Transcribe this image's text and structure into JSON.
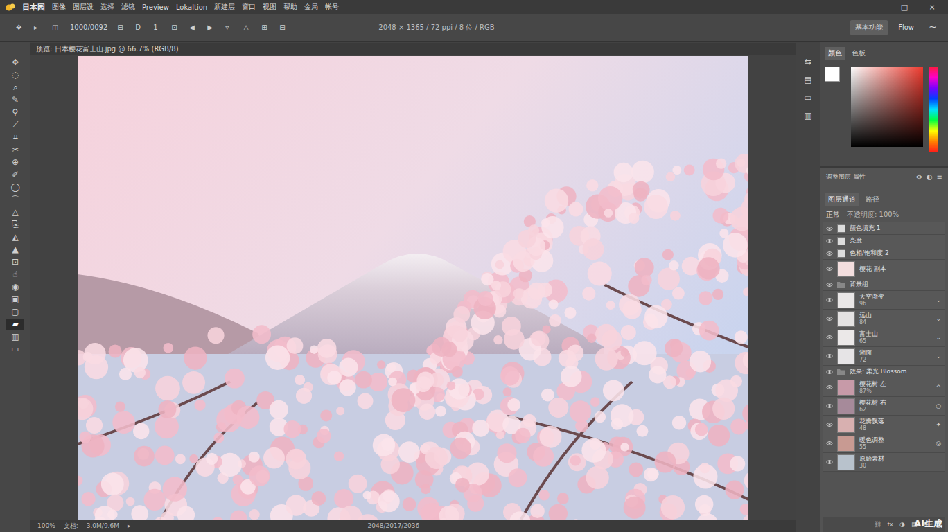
{
  "window": {
    "app_title": "日本园",
    "controls": [
      "—",
      "□",
      "×"
    ]
  },
  "menus": [
    "图像",
    "图层设",
    "选择",
    "滤镜",
    "Preview",
    "Lokaltion",
    "新建层",
    "窗口",
    "视图",
    "帮助",
    "金局",
    "帐号"
  ],
  "options": [
    "✥",
    "▸",
    "◫",
    "1000/0092",
    "⊟",
    "D",
    "1",
    "⊡",
    "◀",
    "▶",
    "▿",
    "△",
    "⊞",
    "⊟"
  ],
  "document_info": "2048 × 1365 / 72 ppi / 8 位 / RGB",
  "workspace_buttons": [
    {
      "label": "基本功能",
      "selected": true
    },
    {
      "label": "Flow",
      "selected": false
    },
    {
      "label": "⁓",
      "selected": false
    }
  ],
  "document_tab": "预览: 日本樱花富士山.jpg @ 66.7% (RGB/8)",
  "tools": [
    {
      "icon": "✥",
      "selected": false
    },
    {
      "icon": "◌",
      "selected": false
    },
    {
      "icon": "⌕",
      "selected": false
    },
    {
      "icon": "✎",
      "selected": false
    },
    {
      "icon": "⚲",
      "selected": false
    },
    {
      "icon": "⟋",
      "selected": false
    },
    {
      "icon": "⌗",
      "selected": false
    },
    {
      "icon": "✂",
      "selected": false
    },
    {
      "icon": "⊕",
      "selected": false
    },
    {
      "icon": "✐",
      "selected": false
    },
    {
      "icon": "◯",
      "selected": false
    },
    {
      "icon": "⌒",
      "selected": false
    },
    {
      "icon": "△",
      "selected": false
    },
    {
      "icon": "⎘",
      "selected": false
    },
    {
      "icon": "◭",
      "selected": false
    },
    {
      "icon": "▲",
      "selected": false
    },
    {
      "icon": "⊡",
      "selected": false
    },
    {
      "icon": "☝",
      "selected": false
    },
    {
      "icon": "◉",
      "selected": false
    },
    {
      "icon": "▣",
      "selected": false
    },
    {
      "icon": "▢",
      "selected": false
    },
    {
      "icon": "▰",
      "selected": true
    },
    {
      "icon": "▥",
      "selected": false
    },
    {
      "icon": "▭",
      "selected": false
    }
  ],
  "side_icons": [
    "⇆",
    "▤",
    "▭",
    "▥"
  ],
  "color_panel": {
    "tabs": [
      {
        "label": "颜色",
        "selected": true
      },
      {
        "label": "色板",
        "selected": false
      }
    ],
    "foreground": "#ffffff"
  },
  "layers_panel": {
    "header": "调整图层 属性",
    "header_icons": [
      "⚙",
      "◐",
      "≡"
    ],
    "tabs": [
      {
        "label": "图层通道",
        "selected": true
      },
      {
        "label": "路径",
        "selected": false
      }
    ],
    "blend_mode": "正常",
    "opacity": "不透明度: 100%",
    "layers": [
      {
        "kind": "adjust",
        "name": "颜色填充 1",
        "sub": "",
        "mark": "",
        "visible": true,
        "color": "#dcdcdc"
      },
      {
        "kind": "adjust",
        "name": "亮度",
        "sub": "",
        "mark": "",
        "visible": true,
        "color": "#dcdcdc"
      },
      {
        "kind": "adjust",
        "name": "色相/饱和度 2",
        "sub": "",
        "mark": "",
        "visible": true,
        "color": "#dcdcdc"
      },
      {
        "kind": "layer",
        "name": "樱花 副本",
        "sub": "",
        "mark": "",
        "visible": true,
        "color": "#f3dede"
      },
      {
        "kind": "group",
        "name": "背景组",
        "sub": "",
        "mark": "",
        "visible": true,
        "color": "#888888"
      },
      {
        "kind": "layer",
        "name": "天空渐变",
        "sub": "96",
        "mark": "⌄",
        "visible": true,
        "color": "#e9e6e6"
      },
      {
        "kind": "layer",
        "name": "远山",
        "sub": "84",
        "mark": "⌄",
        "visible": true,
        "color": "#e4e2e2"
      },
      {
        "kind": "layer",
        "name": "富士山",
        "sub": "65",
        "mark": "⌄",
        "visible": true,
        "color": "#ebe8e8"
      },
      {
        "kind": "layer",
        "name": "湖面",
        "sub": "72",
        "mark": "⌄",
        "visible": true,
        "color": "#e6e4e6"
      },
      {
        "kind": "group",
        "name": "效果: 柔光 Blossom",
        "sub": "",
        "mark": "",
        "visible": true,
        "color": "#888888"
      },
      {
        "kind": "layer",
        "name": "樱花树 左",
        "sub": "87%",
        "mark": "^",
        "visible": true,
        "color": "#c79aa8"
      },
      {
        "kind": "layer",
        "name": "樱花树 右",
        "sub": "62",
        "mark": "○",
        "visible": true,
        "color": "#a68a9a"
      },
      {
        "kind": "layer",
        "name": "花瓣飘落",
        "sub": "48",
        "mark": "✦",
        "visible": true,
        "color": "#d8b0b0"
      },
      {
        "kind": "layer",
        "name": "暖色调整",
        "sub": "55",
        "mark": "◎",
        "visible": true,
        "color": "#c89a92"
      },
      {
        "kind": "layer",
        "name": "原始素材",
        "sub": "30",
        "mark": "",
        "visible": true,
        "color": "#b8c2cc"
      }
    ],
    "footer_icons": [
      "⛓",
      "fx",
      "◑",
      "▤",
      "⊞",
      "🗑"
    ]
  },
  "status_bar": {
    "left": [
      "100%",
      "文档:",
      "3.0M/9.6M",
      "▸"
    ],
    "center": "2048/2017/2036"
  },
  "watermark": "AI生成"
}
